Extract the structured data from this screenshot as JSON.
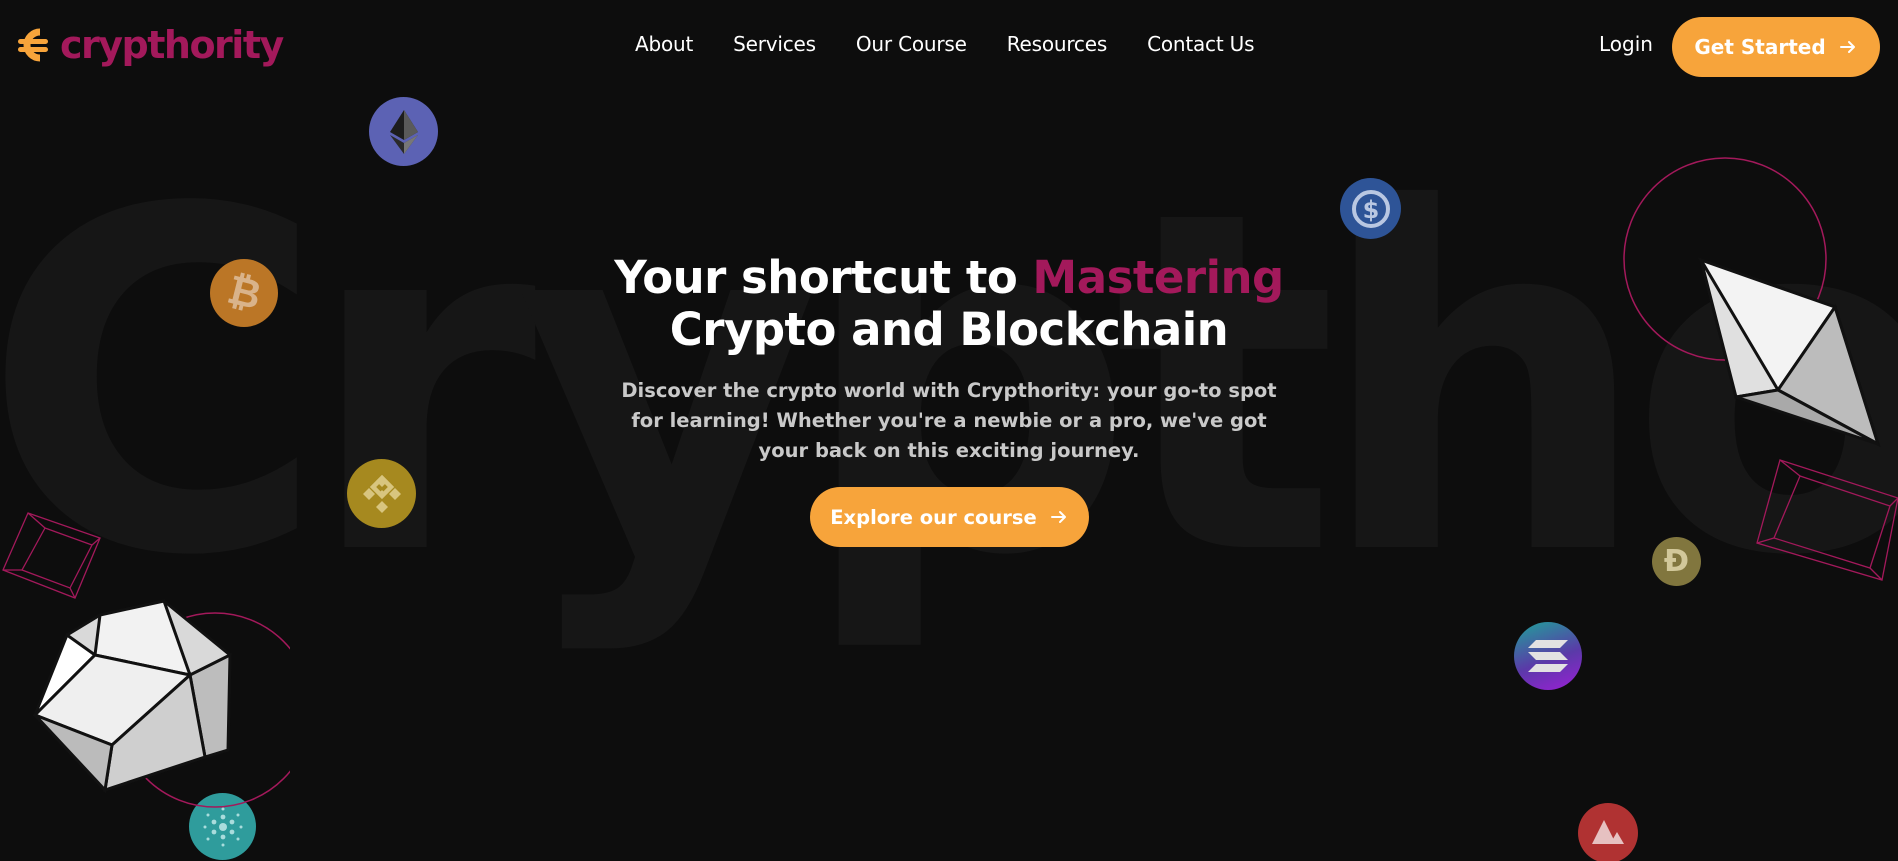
{
  "background": {
    "watermark": "Crypthority"
  },
  "header": {
    "logo_text": "crypthority",
    "nav": [
      "About",
      "Services",
      "Our Course",
      "Resources",
      "Contact Us"
    ],
    "login_label": "Login",
    "cta_label": "Get Started"
  },
  "hero": {
    "title_part1": "Your shortcut to ",
    "title_accent": "Mastering",
    "title_part2": "Crypto and Blockchain",
    "subtitle": "Discover the crypto world with Crypthority: your go-to spot for learning! Whether you're a newbie or a pro, we've got your back on this exciting journey.",
    "button_label": "Explore our course"
  },
  "colors": {
    "background": "#0d0d0d",
    "brand": "#a3195b",
    "accent": "#f7a43b",
    "text": "#ffffff",
    "subtext": "#c9c9c9"
  },
  "decorations": {
    "coins": [
      "ethereum-icon",
      "bitcoin-icon",
      "binance-icon",
      "usdc-icon",
      "dogecoin-icon",
      "solana-icon",
      "avalanche-icon",
      "cardano-icon"
    ],
    "shapes": [
      "icosahedron",
      "octahedron",
      "wireframe-cube"
    ]
  }
}
